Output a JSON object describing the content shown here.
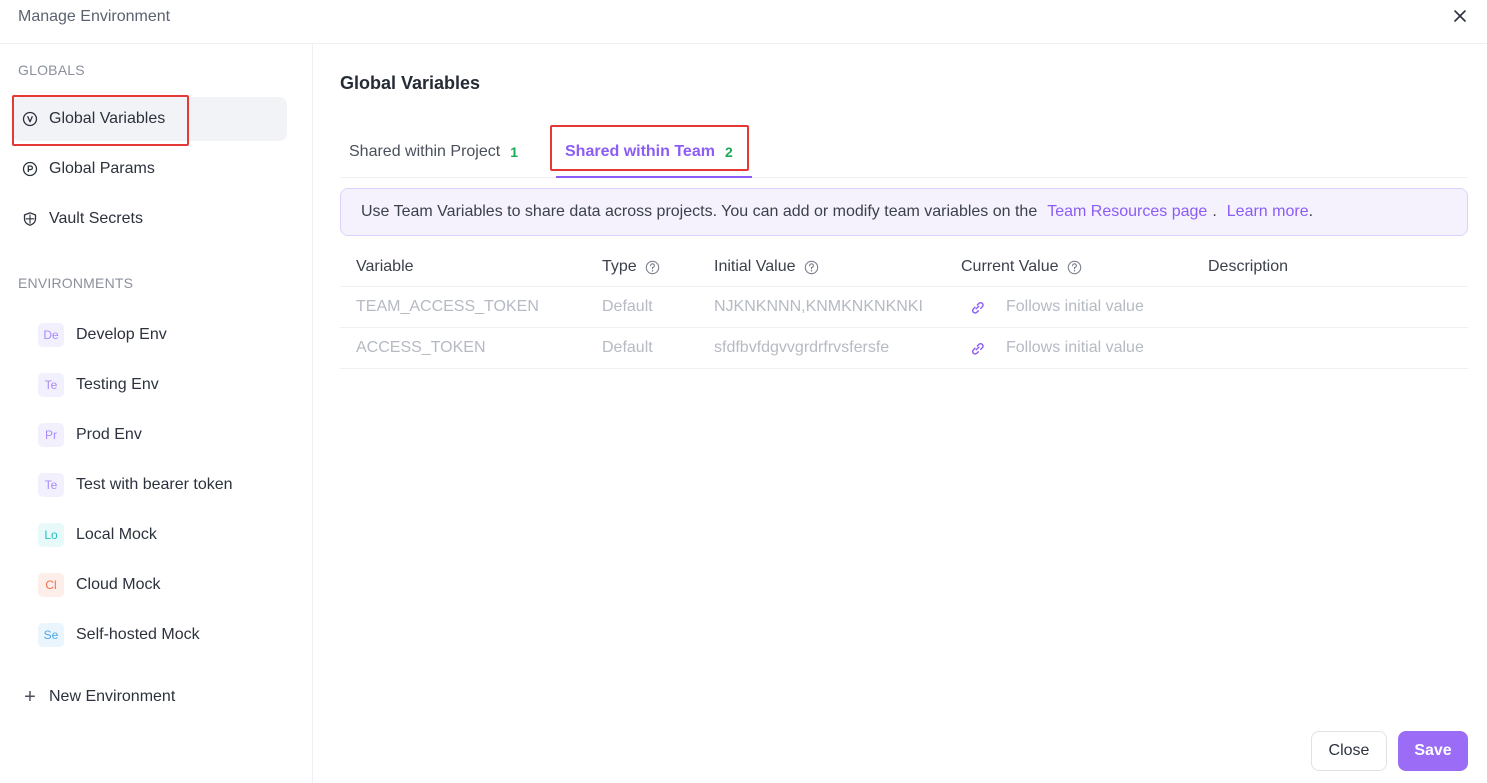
{
  "window": {
    "title": "Manage Environment",
    "close_icon": "close-icon"
  },
  "sidebar": {
    "globals_label": "GLOBALS",
    "globals_items": [
      {
        "label": "Global Variables",
        "icon": "variable-icon",
        "active": true
      },
      {
        "label": "Global Params",
        "icon": "params-icon",
        "active": false
      },
      {
        "label": "Vault Secrets",
        "icon": "vault-icon",
        "active": false
      }
    ],
    "environments_label": "ENVIRONMENTS",
    "environments": [
      {
        "badge": "De",
        "label": "Develop Env",
        "badge_color": "#a78bfa",
        "badge_bg": "#f3f0fe"
      },
      {
        "badge": "Te",
        "label": "Testing Env",
        "badge_color": "#a78bfa",
        "badge_bg": "#f3f0fe"
      },
      {
        "badge": "Pr",
        "label": "Prod Env",
        "badge_color": "#a78bfa",
        "badge_bg": "#f3f0fe"
      },
      {
        "badge": "Te",
        "label": "Test with bearer token",
        "badge_color": "#a78bfa",
        "badge_bg": "#f3f0fe"
      },
      {
        "badge": "Lo",
        "label": "Local Mock",
        "badge_color": "#22c3c3",
        "badge_bg": "#e8f9f9"
      },
      {
        "badge": "Cl",
        "label": "Cloud Mock",
        "badge_color": "#f07050",
        "badge_bg": "#fdeeea"
      },
      {
        "badge": "Se",
        "label": "Self-hosted Mock",
        "badge_color": "#4aa8e8",
        "badge_bg": "#eaf5fd"
      }
    ],
    "new_env_label": "New Environment"
  },
  "main": {
    "title": "Global Variables",
    "tabs": [
      {
        "label": "Shared within Project",
        "count": "1"
      },
      {
        "label": "Shared within Team",
        "count": "2"
      }
    ],
    "notice": {
      "text": "Use Team Variables to share data across projects. You can add or modify team variables on the",
      "link1": "Team Resources page",
      "sep": ".",
      "link2": "Learn more",
      "end": "."
    },
    "table": {
      "headers": [
        "Variable",
        "Type",
        "Initial Value",
        "Current Value",
        "Description"
      ],
      "rows": [
        {
          "variable": "TEAM_ACCESS_TOKEN",
          "type": "Default",
          "initial": "NJKNKNNN,KNMKNKNKNKI",
          "current": "Follows initial value",
          "description": ""
        },
        {
          "variable": "ACCESS_TOKEN",
          "type": "Default",
          "initial": "sfdfbvfdgvvgrdrfrvsfersfe",
          "current": "Follows initial value",
          "description": ""
        }
      ]
    }
  },
  "footer": {
    "close_label": "Close",
    "save_label": "Save"
  },
  "colors": {
    "accent": "#8b5cf6",
    "count_green": "#1aaa55",
    "highlight_red": "#e53935"
  }
}
